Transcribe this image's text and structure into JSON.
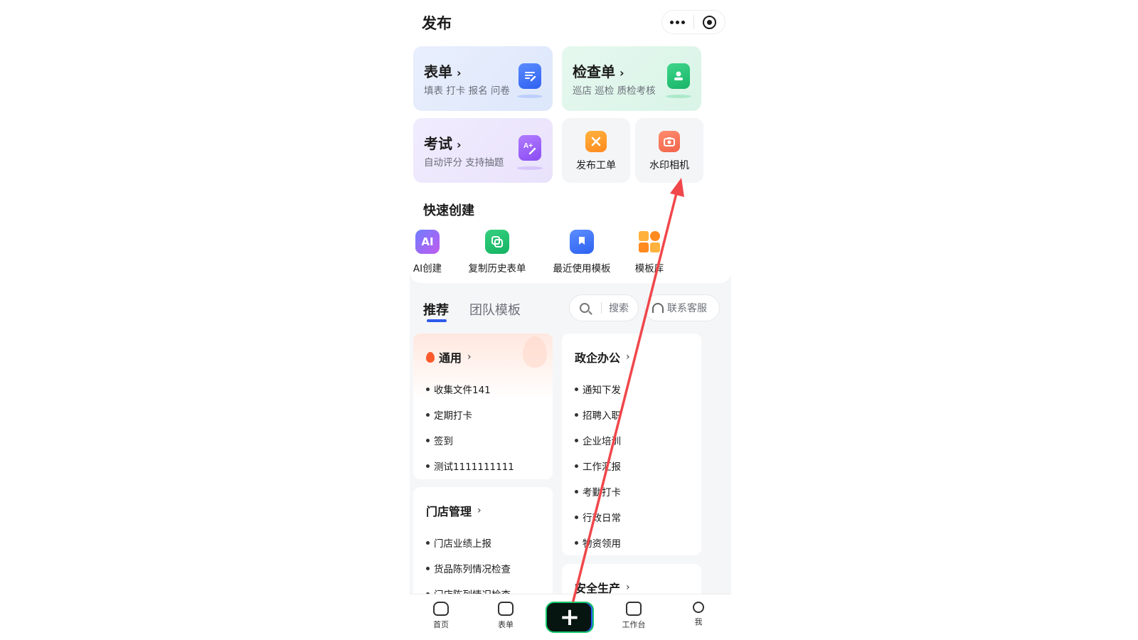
{
  "header": {
    "title": "发布"
  },
  "cards": {
    "form": {
      "title": "表单",
      "subtitle": "填表 打卡 报名 问卷"
    },
    "checklist": {
      "title": "检查单",
      "subtitle": "巡店 巡检 质检考核"
    },
    "exam": {
      "title": "考试",
      "subtitle": "自动评分 支持抽题"
    },
    "work_order": {
      "label": "发布工单"
    },
    "watermark_camera": {
      "label": "水印相机"
    }
  },
  "quick_create": {
    "title": "快速创建",
    "items": [
      {
        "label": "AI创建",
        "icon": "ai-icon"
      },
      {
        "label": "复制历史表单",
        "icon": "copy-icon"
      },
      {
        "label": "最近使用模板",
        "icon": "bookmark-icon"
      },
      {
        "label": "模板库",
        "icon": "template-library-icon"
      }
    ]
  },
  "tabs": {
    "recommend": "推荐",
    "team": "团队模板"
  },
  "search": {
    "label": "搜索"
  },
  "service": {
    "label": "联系客服"
  },
  "categories": {
    "general": {
      "title": "通用",
      "items": [
        "收集文件141",
        "定期打卡",
        "签到",
        "测试1111111111"
      ]
    },
    "government": {
      "title": "政企办公",
      "items": [
        "通知下发",
        "招聘入职",
        "企业培训",
        "工作汇报",
        "考勤打卡",
        "行政日常",
        "物资领用"
      ]
    },
    "store": {
      "title": "门店管理",
      "items": [
        "门店业绩上报",
        "货品陈列情况检查",
        "门店陈列情况检查"
      ]
    },
    "safety": {
      "title": "安全生产"
    }
  },
  "tabbar": {
    "home": "首页",
    "form": "表单",
    "workbench": "工作台",
    "me": "我"
  },
  "colors": {
    "accent": "#2f5bea",
    "annotation_arrow": "#f0474b"
  }
}
